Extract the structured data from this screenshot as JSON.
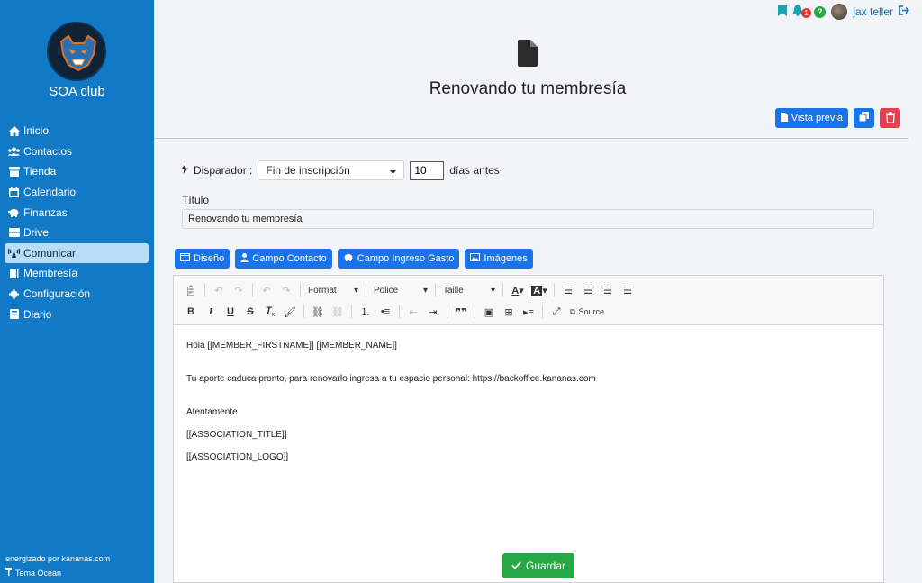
{
  "sidebar": {
    "club_name": "SOA club",
    "items": [
      {
        "label": "Inicio",
        "icon": "home-icon"
      },
      {
        "label": "Contactos",
        "icon": "users-icon"
      },
      {
        "label": "Tienda",
        "icon": "store-icon"
      },
      {
        "label": "Calendario",
        "icon": "calendar-icon"
      },
      {
        "label": "Finanzas",
        "icon": "piggy-bank-icon"
      },
      {
        "label": "Drive",
        "icon": "drive-icon"
      },
      {
        "label": "Comunicar",
        "icon": "broadcast-icon",
        "active": true
      },
      {
        "label": "Membresía",
        "icon": "book-icon"
      },
      {
        "label": "Configuración",
        "icon": "gear-icon"
      },
      {
        "label": "Diario",
        "icon": "journal-icon"
      }
    ],
    "footer_powered": "energizado por kananas.com",
    "footer_theme": "Tema Ocean"
  },
  "topbar": {
    "notification_count": "1",
    "help": "?",
    "user_name": "jax teller"
  },
  "header": {
    "title": "Renovando tu membresía",
    "preview_label": "Vista previa"
  },
  "form": {
    "trigger_label": "Disparador :",
    "trigger_value": "Fin de inscripción",
    "days_value": "10",
    "days_suffix": "días antes",
    "title_label": "Título",
    "title_value": "Renovando tu membresía"
  },
  "tools": {
    "design": "Diseño",
    "contact_field": "Campo Contacto",
    "income_field": "Campo Ingreso Gasto",
    "images": "Imágenes"
  },
  "editor": {
    "format": "Format",
    "police": "Police",
    "taille": "Taille",
    "source": "Source",
    "lines": [
      "Hola [[MEMBER_FIRSTNAME]] [[MEMBER_NAME]]",
      "Tu aporte caduca pronto, para renovarlo ingresa a tu espacio personal: https://backoffice.kananas.com",
      "Atentamente",
      "[[ASSOCIATION_TITLE]]",
      "[[ASSOCIATION_LOGO]]"
    ]
  },
  "actions": {
    "save": "Guardar"
  },
  "colors": {
    "sidebar": "#1279c6",
    "primary": "#1a73e8",
    "danger": "#e04352",
    "success": "#28a745"
  }
}
